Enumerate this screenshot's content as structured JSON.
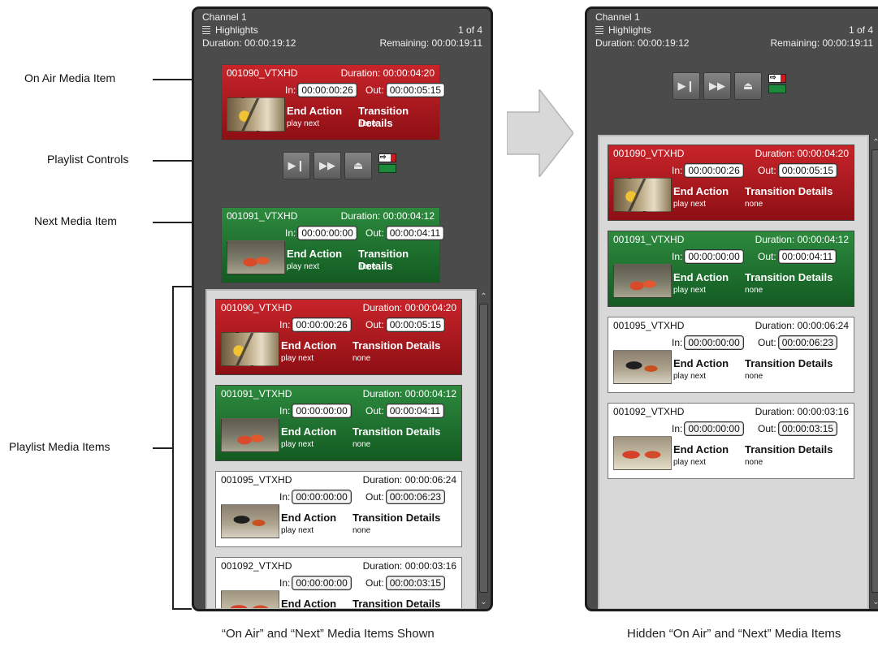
{
  "annotations": {
    "on_air": "On Air Media Item",
    "playlist_controls": "Playlist Controls",
    "next": "Next Media Item",
    "playlist_items": "Playlist Media Items"
  },
  "captions": {
    "left": "“On Air” and “Next” Media Items Shown",
    "right": "Hidden “On Air” and “Next” Media Items"
  },
  "channel": {
    "title": "Channel 1",
    "playlist": "Highlights",
    "count": "1 of 4",
    "duration": "Duration: 00:00:19:12",
    "remaining": "Remaining: 00:00:19:11"
  },
  "labels": {
    "in": "In:",
    "out": "Out:",
    "end_action": "End Action",
    "transition_details": "Transition Details"
  },
  "media": {
    "item_1090": {
      "name": "001090_VTXHD",
      "duration": "Duration: 00:00:04:20",
      "in": "00:00:00:26",
      "out": "00:00:05:15",
      "end_action": "play next",
      "transition": "none"
    },
    "item_1091": {
      "name": "001091_VTXHD",
      "duration": "Duration: 00:00:04:12",
      "in": "00:00:00:00",
      "out": "00:00:04:11",
      "end_action": "play next",
      "transition": "none"
    },
    "item_1095": {
      "name": "001095_VTXHD",
      "duration": "Duration: 00:00:06:24",
      "in": "00:00:00:00",
      "out": "00:00:06:23",
      "end_action": "play next",
      "transition": "none"
    },
    "item_1092": {
      "name": "001092_VTXHD",
      "duration": "Duration: 00:00:03:16",
      "in": "00:00:00:00",
      "out": "00:00:03:15",
      "end_action": "play next",
      "transition": "none"
    }
  },
  "controls": [
    "play-next-icon",
    "fast-forward-icon",
    "eject-icon",
    "status-icon"
  ],
  "colors": {
    "on_air": "#b01a20",
    "next": "#1f7a33",
    "panel": "#4b4b4b"
  }
}
